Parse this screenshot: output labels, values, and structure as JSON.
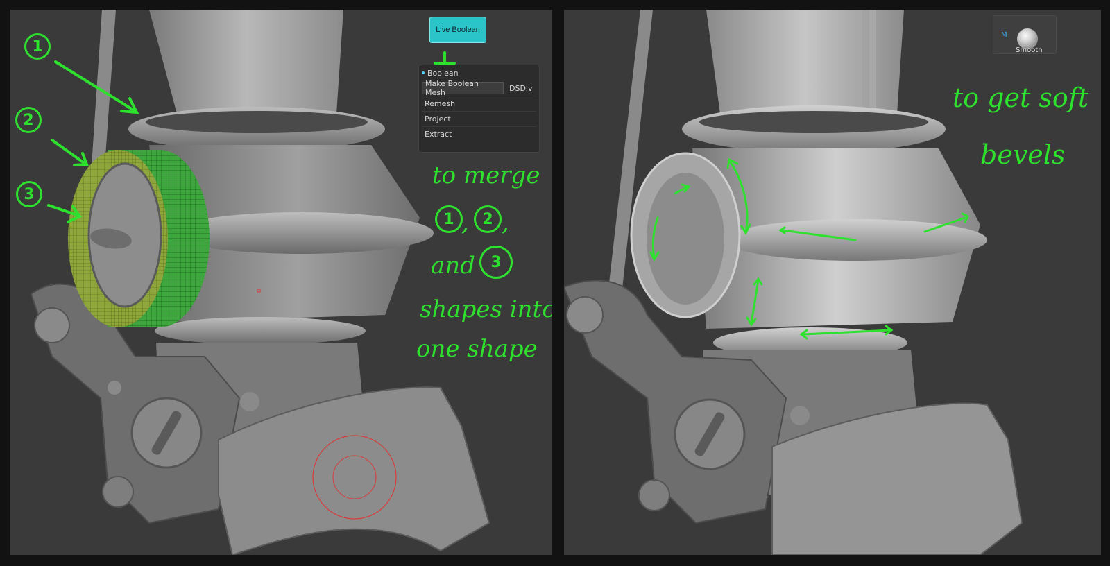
{
  "left_view": {
    "live_boolean_label": "Live Boolean",
    "plus_glyph": "+",
    "boolean_panel": {
      "header": "Boolean",
      "make_boolean_mesh": "Make Boolean Mesh",
      "dsdiv": "DSDiv",
      "items": [
        "Remesh",
        "Project",
        "Extract"
      ]
    },
    "callouts": [
      "1",
      "2",
      "3"
    ],
    "annotation": {
      "line1": "to merge",
      "line2_a": "1",
      "line2_b": "2",
      "line3_a": "and",
      "line3_b": "3",
      "line4": "shapes into",
      "line5": "one shape"
    }
  },
  "right_view": {
    "material": {
      "tag": "M",
      "name": "Smooth"
    },
    "annotation": {
      "line1": "to get soft",
      "line2": "bevels"
    }
  },
  "colors": {
    "annotation_green": "#2fe12f",
    "live_boolean_cyan": "#2bc4c8",
    "material_tag_blue": "#3fb7ff",
    "brush_ring_red": "#d83a3a"
  }
}
